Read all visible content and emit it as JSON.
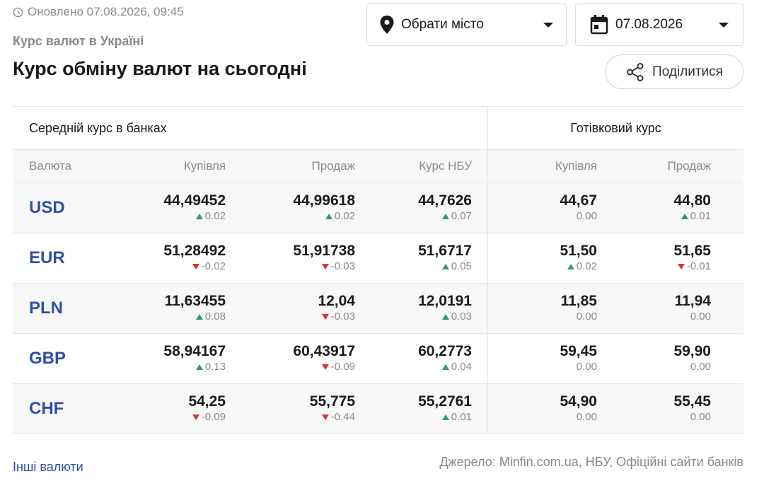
{
  "header": {
    "updated": "Оновлено 07.08.2026, 09:45",
    "subtitle": "Курс валют в Україні",
    "title": "Курс обміну валют на сьогодні"
  },
  "controls": {
    "city_label": "Обрати місто",
    "date_label": "07.08.2026",
    "share_label": "Поділитися"
  },
  "table": {
    "group_banks": "Середній курс в банках",
    "group_cash": "Готівковий курс",
    "headers": [
      "Валюта",
      "Купівля",
      "Продаж",
      "Курс НБУ",
      "Купівля",
      "Продаж"
    ],
    "rows": [
      {
        "code": "USD",
        "cells": [
          {
            "v": "44,49452",
            "d": "0.02",
            "dir": "up"
          },
          {
            "v": "44,99618",
            "d": "0.02",
            "dir": "up"
          },
          {
            "v": "44,7626",
            "d": "0.07",
            "dir": "up"
          },
          {
            "v": "44,67",
            "d": "0.00",
            "dir": "none"
          },
          {
            "v": "44,80",
            "d": "0.01",
            "dir": "up"
          }
        ]
      },
      {
        "code": "EUR",
        "cells": [
          {
            "v": "51,28492",
            "d": "-0.02",
            "dir": "down"
          },
          {
            "v": "51,91738",
            "d": "-0.03",
            "dir": "down"
          },
          {
            "v": "51,6717",
            "d": "0.05",
            "dir": "up"
          },
          {
            "v": "51,50",
            "d": "0.02",
            "dir": "up"
          },
          {
            "v": "51,65",
            "d": "-0.01",
            "dir": "down"
          }
        ]
      },
      {
        "code": "PLN",
        "cells": [
          {
            "v": "11,63455",
            "d": "0.08",
            "dir": "up"
          },
          {
            "v": "12,04",
            "d": "-0.03",
            "dir": "down"
          },
          {
            "v": "12,0191",
            "d": "0.03",
            "dir": "up"
          },
          {
            "v": "11,85",
            "d": "0.00",
            "dir": "none"
          },
          {
            "v": "11,94",
            "d": "0.00",
            "dir": "none"
          }
        ]
      },
      {
        "code": "GBP",
        "cells": [
          {
            "v": "58,94167",
            "d": "0.13",
            "dir": "up"
          },
          {
            "v": "60,43917",
            "d": "-0.09",
            "dir": "down"
          },
          {
            "v": "60,2773",
            "d": "0.04",
            "dir": "up"
          },
          {
            "v": "59,45",
            "d": "0.00",
            "dir": "none"
          },
          {
            "v": "59,90",
            "d": "0.00",
            "dir": "none"
          }
        ]
      },
      {
        "code": "CHF",
        "cells": [
          {
            "v": "54,25",
            "d": "-0.09",
            "dir": "down"
          },
          {
            "v": "55,775",
            "d": "-0.44",
            "dir": "down"
          },
          {
            "v": "55,2761",
            "d": "0.01",
            "dir": "up"
          },
          {
            "v": "54,90",
            "d": "0.00",
            "dir": "none"
          },
          {
            "v": "55,45",
            "d": "0.00",
            "dir": "none"
          }
        ]
      }
    ]
  },
  "footer": {
    "other_link": "Інші валюти",
    "source": "Джерело: Minfin.com.ua, НБУ, Офіційні сайти банків"
  },
  "colors": {
    "accent": "#2e4fa6",
    "up": "#2e9c6b",
    "down": "#d9342b",
    "muted": "#8a8a8a"
  }
}
